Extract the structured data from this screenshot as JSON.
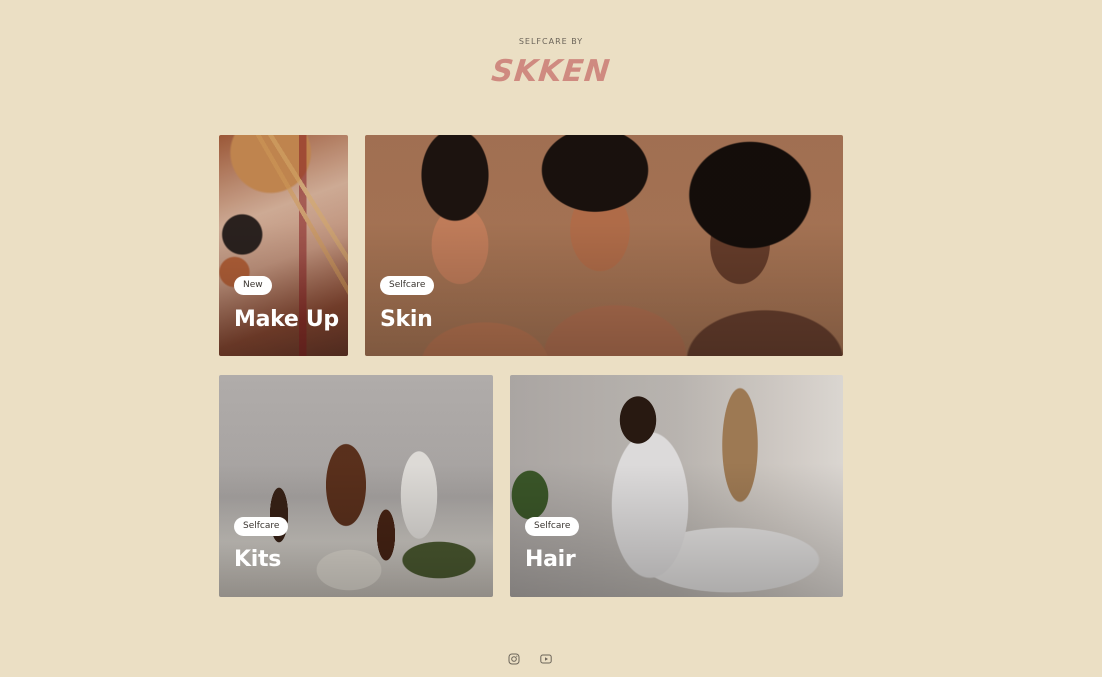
{
  "header": {
    "tagline": "SELFCARE BY",
    "logo": "SKKEN"
  },
  "cards": [
    {
      "badge": "New",
      "title": "Make Up"
    },
    {
      "badge": "Selfcare",
      "title": "Skin"
    },
    {
      "badge": "Selfcare",
      "title": "Kits"
    },
    {
      "badge": "Selfcare",
      "title": "Hair"
    }
  ],
  "footer": {
    "icons": [
      "instagram-icon",
      "youtube-icon"
    ]
  },
  "colors": {
    "background": "#ebdfc4",
    "logo": "#cf8a80",
    "badge_bg": "#ffffff",
    "title_text": "#ffffff"
  }
}
